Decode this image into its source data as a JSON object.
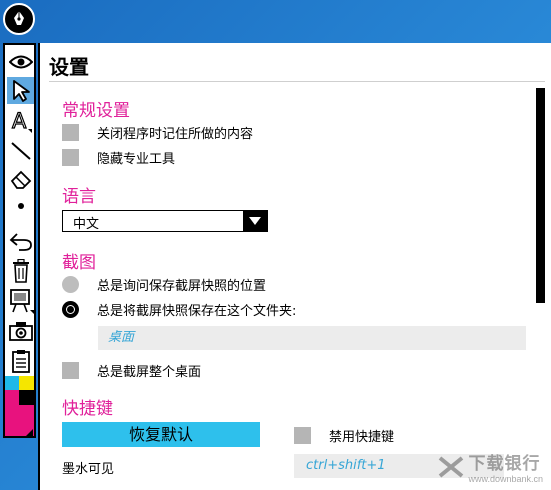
{
  "panel": {
    "title": "设置",
    "general": {
      "heading": "常规设置",
      "remember_label": "关闭程序时记住所做的内容",
      "hide_pro_label": "隐藏专业工具"
    },
    "language": {
      "heading": "语言",
      "selected": "中文"
    },
    "screenshot": {
      "heading": "截图",
      "ask_label": "总是询问保存截屏快照的位置",
      "folder_label": "总是将截屏快照保存在这个文件夹:",
      "folder_value": "桌面",
      "fullscreen_label": "总是截屏整个桌面"
    },
    "shortcuts": {
      "heading": "快捷键",
      "restore_label": "恢复默认",
      "disable_label": "禁用快捷键",
      "ink_visible_label": "墨水可见",
      "ink_visible_shortcut": "ctrl+shift+1"
    }
  },
  "watermark": {
    "main": "下载银行",
    "sub": "www.downbank.cn"
  },
  "colors": {
    "accent_pink": "#e0209a",
    "button_blue": "#2ec0ec",
    "field_text_blue": "#37a6d6",
    "desktop_blue": "#1e78c8"
  },
  "toolbar_icons": [
    "pen-logo-icon",
    "eye-icon",
    "pointer-icon",
    "text-icon",
    "line-icon",
    "eraser-icon",
    "dot-icon",
    "undo-icon",
    "trash-icon",
    "board-icon",
    "camera-icon",
    "clipboard-icon"
  ]
}
